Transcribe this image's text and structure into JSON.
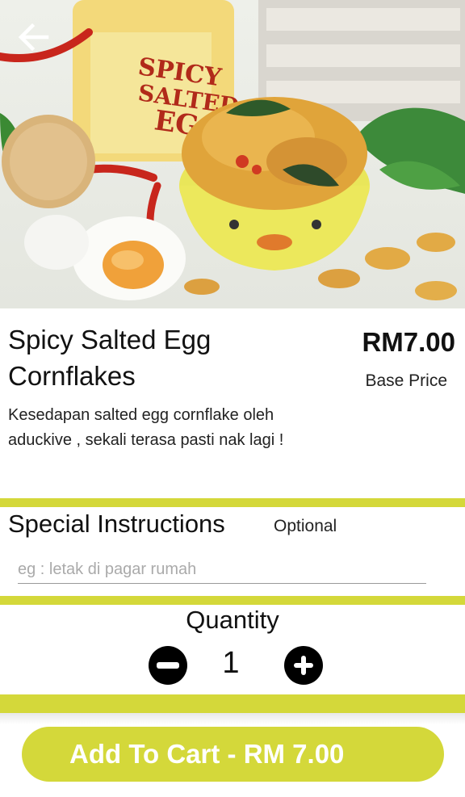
{
  "product": {
    "name": "Spicy Salted Egg Cornflakes",
    "price": "RM7.00",
    "price_caption": "Base Price",
    "description": "Kesedapan salted egg cornflake oleh aduckive , sekali terasa pasti nak lagi !",
    "image_text": "SPICY SALTED EGG"
  },
  "special_instructions": {
    "title": "Special Instructions",
    "optional_label": "Optional",
    "placeholder": "eg : letak di pagar rumah",
    "value": ""
  },
  "quantity": {
    "title": "Quantity",
    "value": "1"
  },
  "cart": {
    "button_label": "Add To Cart - RM 7.00"
  },
  "icons": {
    "back": "arrow-left-icon",
    "minus": "minus-circle-icon",
    "plus": "plus-circle-icon"
  },
  "colors": {
    "accent": "#d4d83a",
    "icon_dark": "#000000",
    "text": "#111111"
  }
}
